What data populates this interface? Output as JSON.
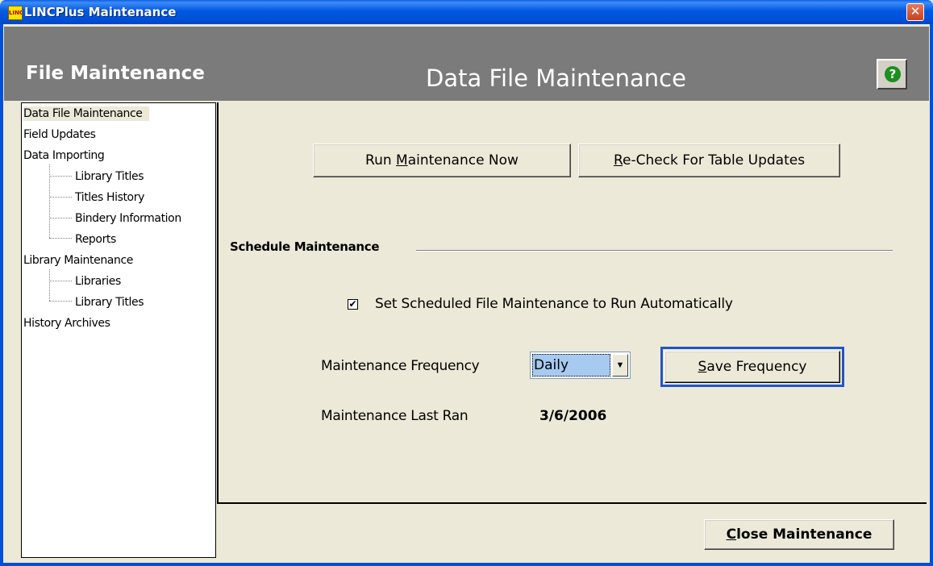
{
  "window": {
    "title": "LINCPlus Maintenance",
    "icon_text": "LINC",
    "close_glyph": "✕"
  },
  "header": {
    "section": "File Maintenance",
    "page_title": "Data File Maintenance",
    "help_glyph": "?"
  },
  "tree": {
    "items": [
      {
        "label": "Data File Maintenance"
      },
      {
        "label": "Field Updates"
      },
      {
        "label": "Data Importing"
      },
      {
        "label": "Library Titles"
      },
      {
        "label": "Titles History"
      },
      {
        "label": "Bindery Information"
      },
      {
        "label": "Reports"
      },
      {
        "label": "Library Maintenance"
      },
      {
        "label": "Libraries"
      },
      {
        "label": "Library Titles"
      },
      {
        "label": "History Archives"
      }
    ]
  },
  "main": {
    "run_button": {
      "pre": "Run ",
      "accel": "M",
      "post": "aintenance Now"
    },
    "recheck_button": {
      "pre": "",
      "accel": "R",
      "post": "e-Check For Table Updates"
    },
    "schedule_label": "Schedule Maintenance",
    "auto_checkbox": {
      "label": "Set Scheduled File Maintenance to Run Automatically",
      "checked": true,
      "mark": "✔"
    },
    "frequency_label": "Maintenance Frequency",
    "frequency_value": "Daily",
    "frequency_arrow": "▼",
    "save_button": {
      "pre": "",
      "accel": "S",
      "post": "ave Frequency"
    },
    "last_ran_label": "Maintenance Last Ran",
    "last_ran_value": "3/6/2006"
  },
  "footer": {
    "close_button": {
      "pre": "",
      "accel": "C",
      "post": "lose Maintenance"
    }
  },
  "colors": {
    "titlebar": "#0054E3",
    "header_bg": "#7B7B7B",
    "dialog_bg": "#ECE9D8",
    "combo_highlight": "#A6CAF0",
    "focus_border": "#2255C8",
    "help_icon": "#1C8F1C"
  }
}
